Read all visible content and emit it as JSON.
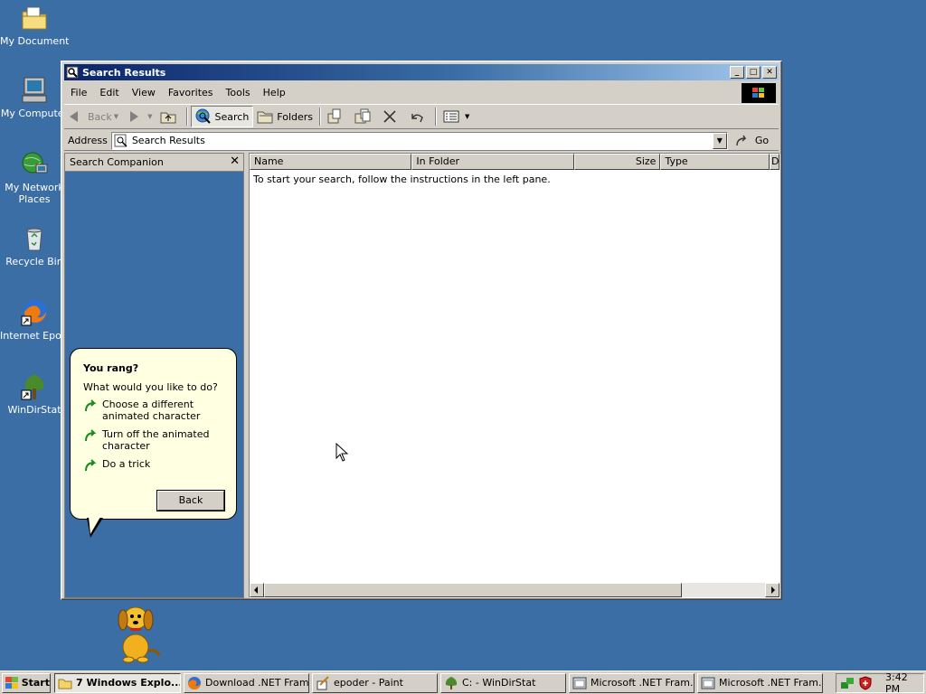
{
  "desktop": {
    "icons": [
      {
        "label": "My Documents",
        "icon": "folder-documents-icon"
      },
      {
        "label": "My Computer",
        "icon": "computer-icon"
      },
      {
        "label1": "My Network",
        "label2": "Places",
        "icon": "network-places-icon"
      },
      {
        "label": "Recycle Bin",
        "icon": "recycle-bin-icon"
      },
      {
        "label": "Internet Epoder",
        "icon": "firefox-icon"
      },
      {
        "label": "WinDirStat",
        "icon": "windirstat-icon"
      }
    ]
  },
  "window": {
    "title": "Search Results",
    "menu": [
      "File",
      "Edit",
      "View",
      "Favorites",
      "Tools",
      "Help"
    ],
    "toolbar": {
      "back": "Back",
      "search": "Search",
      "folders": "Folders"
    },
    "address": {
      "label": "Address",
      "value": "Search Results",
      "go": "Go"
    },
    "left_pane": {
      "title": "Search Companion",
      "close": "✕",
      "balloon": {
        "heading": "You rang?",
        "question": "What would you like to do?",
        "options": [
          {
            "line1": "Choose a different",
            "line2": "animated character"
          },
          {
            "line1": "Turn off the animated",
            "line2": "character"
          },
          {
            "line1": "Do a trick",
            "line2": ""
          }
        ],
        "back_button": "Back"
      }
    },
    "results": {
      "columns": [
        "Name",
        "In Folder",
        "Size",
        "Type",
        "D"
      ],
      "empty_message": "To start your search, follow the instructions in the left pane."
    }
  },
  "taskbar": {
    "start": "Start",
    "tasks": [
      {
        "label": "7 Windows Explo...",
        "icon": "folder-icon",
        "active": true
      },
      {
        "label": "Download .NET Fram...",
        "icon": "firefox-icon",
        "active": false
      },
      {
        "label": "epoder - Paint",
        "icon": "paint-icon",
        "active": false
      },
      {
        "label": "C: - WinDirStat",
        "icon": "windirstat-icon",
        "active": false
      },
      {
        "label": "Microsoft .NET Fram...",
        "icon": "installer-icon",
        "active": false
      },
      {
        "label": "Microsoft .NET Fram...",
        "icon": "installer-icon",
        "active": false
      }
    ],
    "clock": "3:42 PM"
  },
  "colors": {
    "desktop": "#3a6ea5",
    "title_active_start": "#0a246a",
    "title_active_end": "#a6caf0",
    "face": "#d4d0c8",
    "balloon": "#ffffe1"
  }
}
